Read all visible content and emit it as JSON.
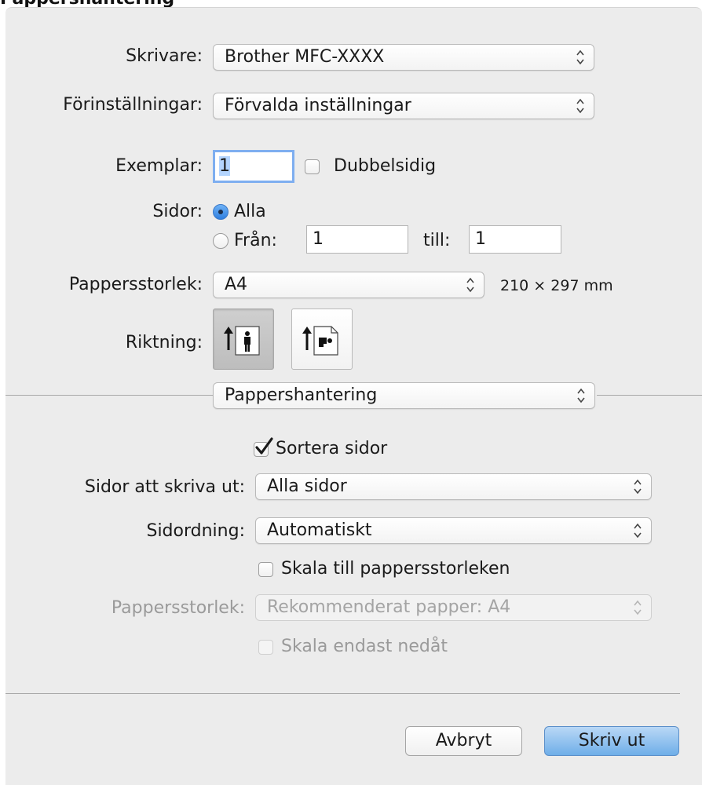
{
  "page_heading": "Pappershantering",
  "printer": {
    "label": "Skrivare:",
    "value": "Brother MFC-XXXX"
  },
  "presets": {
    "label": "Förinställningar:",
    "value": "Förvalda inställningar"
  },
  "copies": {
    "label": "Exemplar:",
    "value": "1",
    "duplex_label": "Dubbelsidig",
    "duplex_checked": false
  },
  "pages": {
    "label": "Sidor:",
    "all_label": "Alla",
    "from_label": "Från:",
    "from_value": "1",
    "to_label": "till:",
    "to_value": "1",
    "selected": "all"
  },
  "paper_size": {
    "label": "Pappersstorlek:",
    "value": "A4",
    "dimensions": "210 × 297 mm"
  },
  "orientation": {
    "label": "Riktning:",
    "selected": "portrait",
    "icons": [
      "portrait-orientation-icon",
      "landscape-orientation-icon"
    ]
  },
  "section": {
    "value": "Pappershantering"
  },
  "collate": {
    "label": "Sortera sidor",
    "checked": true
  },
  "pages_to_print": {
    "label": "Sidor att skriva ut:",
    "value": "Alla sidor"
  },
  "page_order": {
    "label": "Sidordning:",
    "value": "Automatiskt"
  },
  "scale_to_fit": {
    "label": "Skala till pappersstorleken",
    "checked": false
  },
  "dest_paper_size": {
    "label": "Pappersstorlek:",
    "value": "Rekommenderat papper: A4",
    "disabled": true
  },
  "scale_down_only": {
    "label": "Skala endast nedåt",
    "disabled": true
  },
  "buttons": {
    "cancel": "Avbryt",
    "print": "Skriv ut"
  },
  "colors": {
    "dialog_bg": "#ececec",
    "focus_ring": "#7eaef0",
    "default_button": "#6faee8"
  }
}
